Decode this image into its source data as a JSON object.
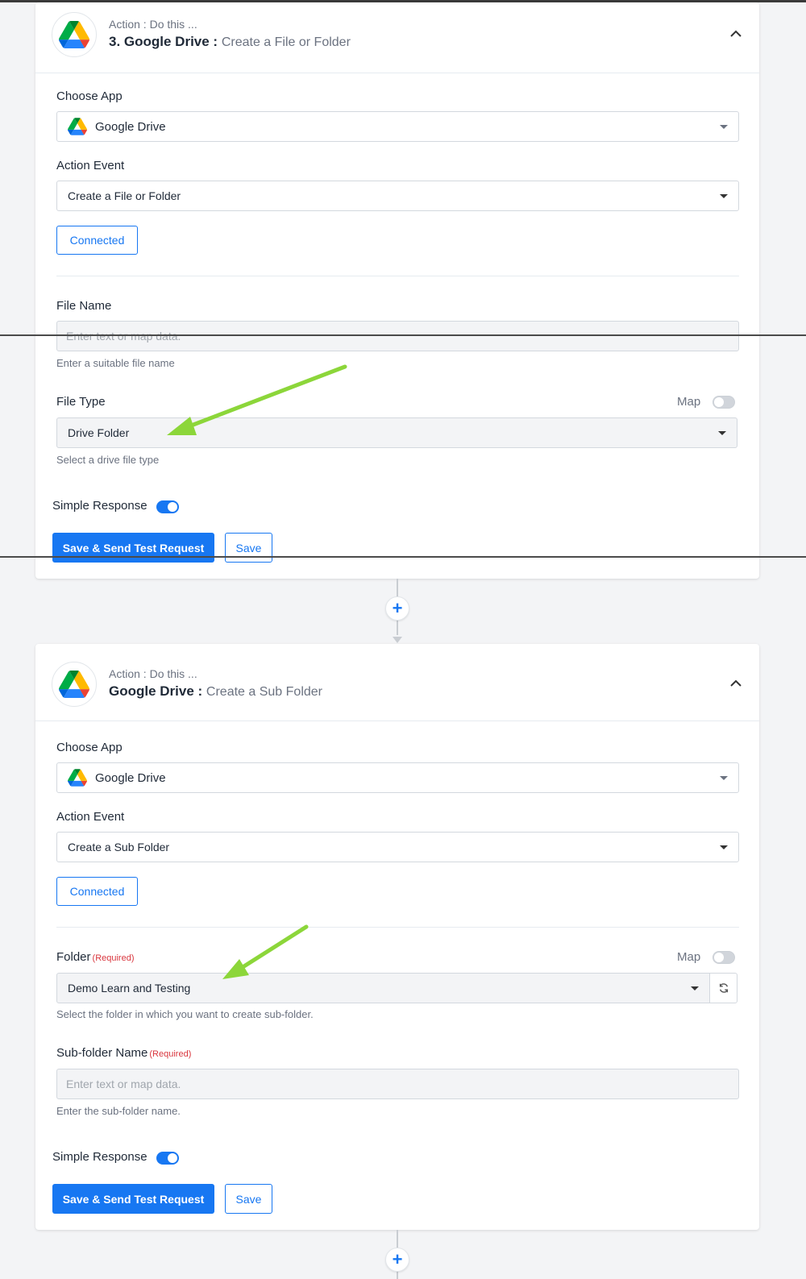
{
  "card1": {
    "header_sub": "Action : Do this ...",
    "header_app": "3. Google Drive :",
    "header_event": "Create a File or Folder",
    "choose_app_label": "Choose App",
    "choose_app_value": "Google Drive",
    "action_event_label": "Action Event",
    "action_event_value": "Create a File or Folder",
    "connected_label": "Connected",
    "file_name_label": "File Name",
    "file_name_placeholder": "Enter text or map data.",
    "file_name_help": "Enter a suitable file name",
    "file_type_label": "File Type",
    "map_label": "Map",
    "file_type_value": "Drive Folder",
    "file_type_help": "Select a drive file type",
    "simple_response_label": "Simple Response",
    "save_send_label": "Save & Send Test Request",
    "save_label": "Save"
  },
  "card2": {
    "header_sub": "Action : Do this ...",
    "header_app": "Google Drive :",
    "header_event": "Create a Sub Folder",
    "choose_app_label": "Choose App",
    "choose_app_value": "Google Drive",
    "action_event_label": "Action Event",
    "action_event_value": "Create a Sub Folder",
    "connected_label": "Connected",
    "folder_label": "Folder",
    "required_label": "(Required)",
    "map_label": "Map",
    "folder_value": "Demo Learn and Testing",
    "folder_help": "Select the folder in which you want to create sub-folder.",
    "subfolder_label": "Sub-folder Name",
    "subfolder_required": "(Required)",
    "subfolder_placeholder": "Enter text or map data.",
    "subfolder_help": "Enter the sub-folder name.",
    "simple_response_label": "Simple Response",
    "save_send_label": "Save & Send Test Request",
    "save_label": "Save"
  },
  "connector": {
    "plus_symbol": "+"
  },
  "icons": {
    "app": "google-drive-icon",
    "collapse": "chevron-up-icon",
    "refresh": "refresh-icon",
    "add": "plus-icon"
  },
  "colors": {
    "accent": "#1777f2",
    "required": "#d9363e",
    "annotation_arrow": "#8cd63a"
  }
}
